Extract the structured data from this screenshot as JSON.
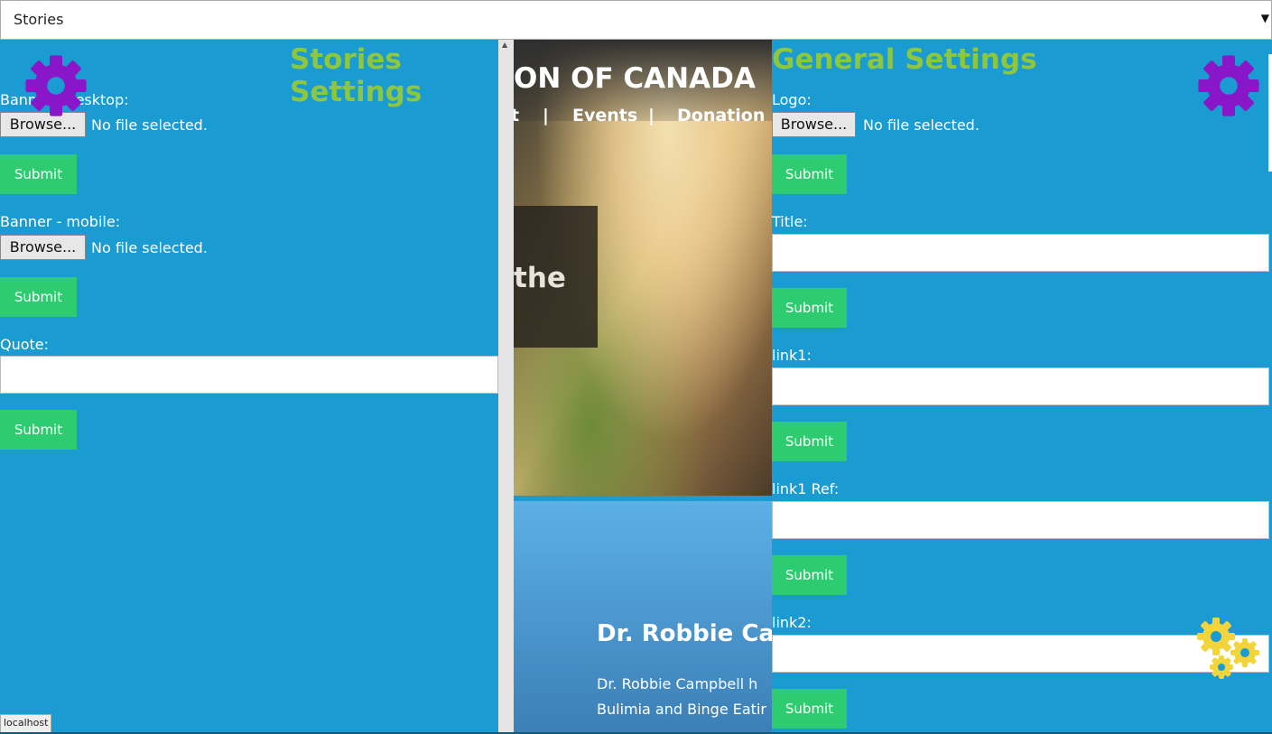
{
  "topbar": {
    "selected": "Stories",
    "caret": "▼"
  },
  "stories_settings": {
    "title": "Stories Settings",
    "banner_desktop_label": "Banner - desktop:",
    "banner_mobile_label": "Banner - mobile:",
    "quote_label": "Quote:",
    "browse_label": "Browse...",
    "no_file_text": "No file selected.",
    "submit_label": "Submit"
  },
  "preview": {
    "org_text": "ON OF CANADA",
    "nav": [
      "t",
      "|",
      "Events",
      "|",
      "Donation"
    ],
    "caption": "the",
    "doctor_name": "Dr. Robbie Ca",
    "doctor_text": [
      "Dr. Robbie Campbell h",
      "Bulimia and Binge Eatir"
    ]
  },
  "general_settings": {
    "title": "General Settings",
    "logo_label": "Logo:",
    "title_label": "Title:",
    "link1_label": "link1:",
    "link1_ref_label": "link1 Ref:",
    "link2_label": "link2:",
    "browse_label": "Browse...",
    "no_file_text": "No file selected.",
    "submit_label": "Submit"
  },
  "status_bar": {
    "text": "localhost"
  },
  "colors": {
    "background": "#1a9bd1",
    "title": "#8dc63f",
    "submit": "#2ecc71",
    "gear_purple": "#8a16c9",
    "gear_yellow": "#f2d53c"
  },
  "icons": [
    "gear-icon",
    "gears-icon"
  ]
}
